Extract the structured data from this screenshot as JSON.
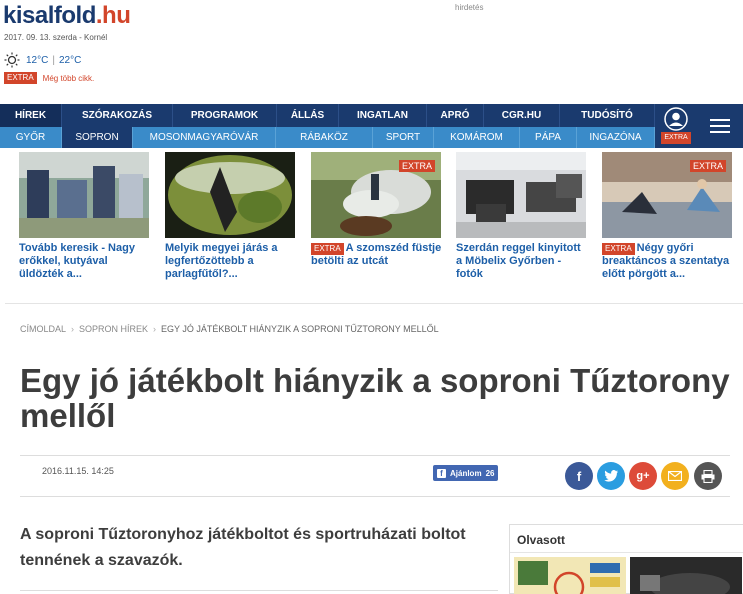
{
  "header": {
    "logo_main": "kisalfold",
    "logo_tld": ".hu",
    "ad_label": "hirdetés",
    "date": "2017. 09. 13. szerda - Kornél",
    "weather": {
      "min": "12°C",
      "max": "22°C",
      "separator": "|"
    },
    "extra_label": "EXTRA",
    "more_articles": "Még több cikk."
  },
  "nav": {
    "primary": [
      "HÍREK",
      "SZÓRAKOZÁS",
      "PROGRAMOK",
      "ÁLLÁS",
      "INGATLAN",
      "APRÓ",
      "CGR.HU",
      "TUDÓSÍTÓ"
    ],
    "secondary": [
      "GYŐR",
      "SOPRON",
      "MOSONMAGYARÓVÁR",
      "RÁBAKÖZ",
      "SPORT",
      "KOMÁROM",
      "PÁPA",
      "INGAZÓNA"
    ],
    "user_extra": "EXTRA"
  },
  "teasers": [
    {
      "extra": false,
      "title": "Tovább keresik - Nagy erőkkel, kutyával üldözték a..."
    },
    {
      "extra": false,
      "title": "Melyik megyei járás a legfertőzöttebb a parlagfűtől?..."
    },
    {
      "extra": true,
      "badge": "EXTRA",
      "caption_badge": "EXTRA",
      "title": "A szomszéd füstje betölti az utcát"
    },
    {
      "extra": false,
      "title": "Szerdán reggel kinyitott a Möbelix Győrben - fotók"
    },
    {
      "extra": true,
      "badge": "EXTRA",
      "caption_badge": "EXTRA",
      "title": "Négy győri breaktáncos a szentatya előtt pörgött a..."
    }
  ],
  "article": {
    "breadcrumb": [
      "CÍMOLDAL",
      "SOPRON HÍREK",
      "EGY JÓ JÁTÉKBOLT HIÁNYZIK A SOPRONI TŰZTORONY MELLŐL"
    ],
    "title": "Egy jó játékbolt hiányzik a soproni Tűztorony mellől",
    "date": "2016.11.15. 14:25",
    "recommend_label": "Ajánlom",
    "recommend_count": "26",
    "lead": "A soproni Tűztoronyhoz játékboltot és sportruházati boltot tennének a szavazók."
  },
  "sidebar": {
    "most_read_title": "Olvasott"
  },
  "share_icons": [
    "facebook-icon",
    "twitter-icon",
    "google-plus-icon",
    "email-icon",
    "print-icon"
  ],
  "colors": {
    "navy": "#1a3a6e",
    "light_blue": "#3a8bc9",
    "accent_red": "#d2452a",
    "link_blue": "#1d5fa8",
    "facebook": "#3b5998",
    "twitter": "#2b9de0",
    "google_plus": "#dd4b39",
    "email": "#f2b01e",
    "print": "#555555"
  }
}
